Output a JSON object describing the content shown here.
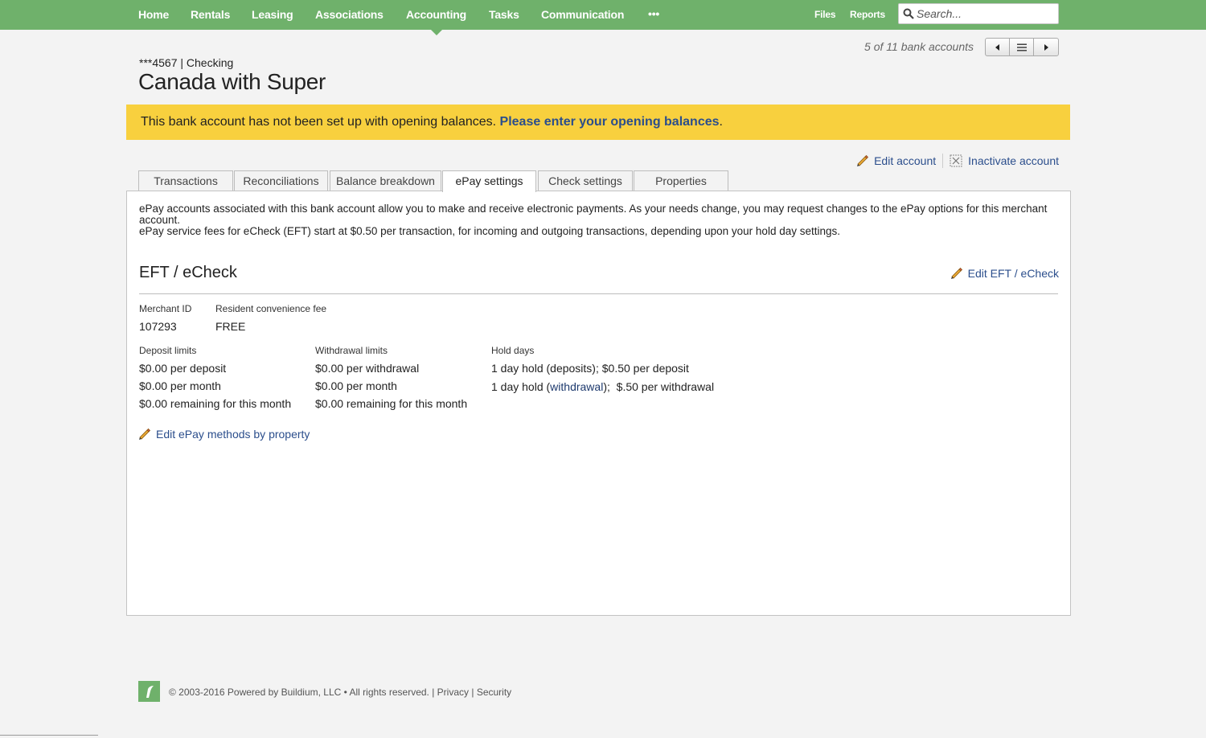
{
  "nav": {
    "items": [
      "Home",
      "Rentals",
      "Leasing",
      "Associations",
      "Accounting",
      "Tasks",
      "Communication",
      "•••"
    ],
    "files": "Files",
    "reports": "Reports",
    "search_placeholder": "Search..."
  },
  "pager": {
    "text": "5 of 11 bank accounts"
  },
  "account": {
    "number_type": "***4567 | Checking",
    "name": "Canada with Super"
  },
  "banner": {
    "message": "This bank account has not been set up with opening balances.",
    "link": "Please enter your opening balances",
    "end": "."
  },
  "actions": {
    "edit_account": "Edit account",
    "inactivate_account": "Inactivate account"
  },
  "tabs": [
    "Transactions",
    "Reconciliations",
    "Balance breakdown",
    "ePay settings",
    "Check settings",
    "Properties"
  ],
  "active_tab": "ePay settings",
  "intro": {
    "line1": "ePay accounts associated with this bank account allow you to make and receive electronic payments. As your needs change, you may request changes to the ePay options for this merchant account.",
    "line2": "ePay service fees for eCheck (EFT) start at $0.50 per transaction, for incoming and outgoing transactions, depending upon your hold day settings."
  },
  "eft": {
    "title": "EFT / eCheck",
    "edit_label": "Edit EFT / eCheck",
    "merchant_id_label": "Merchant ID",
    "merchant_id": "107293",
    "convenience_fee_label": "Resident convenience fee",
    "convenience_fee": "FREE",
    "deposit_limits_label": "Deposit limits",
    "deposit_limits": [
      "$0.00 per deposit",
      "$0.00 per month",
      "$0.00 remaining for this month"
    ],
    "withdrawal_limits_label": "Withdrawal limits",
    "withdrawal_limits": [
      "$0.00 per withdrawal",
      "$0.00 per month",
      "$0.00 remaining for this month"
    ],
    "hold_days_label": "Hold days",
    "hold_deposits": "1 day hold (deposits); $0.50 per deposit",
    "hold_withdrawal_pre": "1 day hold (",
    "hold_withdrawal_link": "withdrawal",
    "hold_withdrawal_post": ");",
    "hold_withdrawal_fee": "$.50",
    "hold_withdrawal_fee_suffix": "per withdrawal",
    "edit_methods": "Edit ePay methods by property"
  },
  "footer": {
    "copyright": "© 2003-2016 Powered by Buildium, LLC • All rights reserved. |",
    "privacy": "Privacy",
    "divider": "|",
    "security": "Security"
  },
  "colors": {
    "nav_green": "#6fb16b",
    "banner_yellow": "#f8d03e",
    "link_blue": "#2b4e8c"
  }
}
